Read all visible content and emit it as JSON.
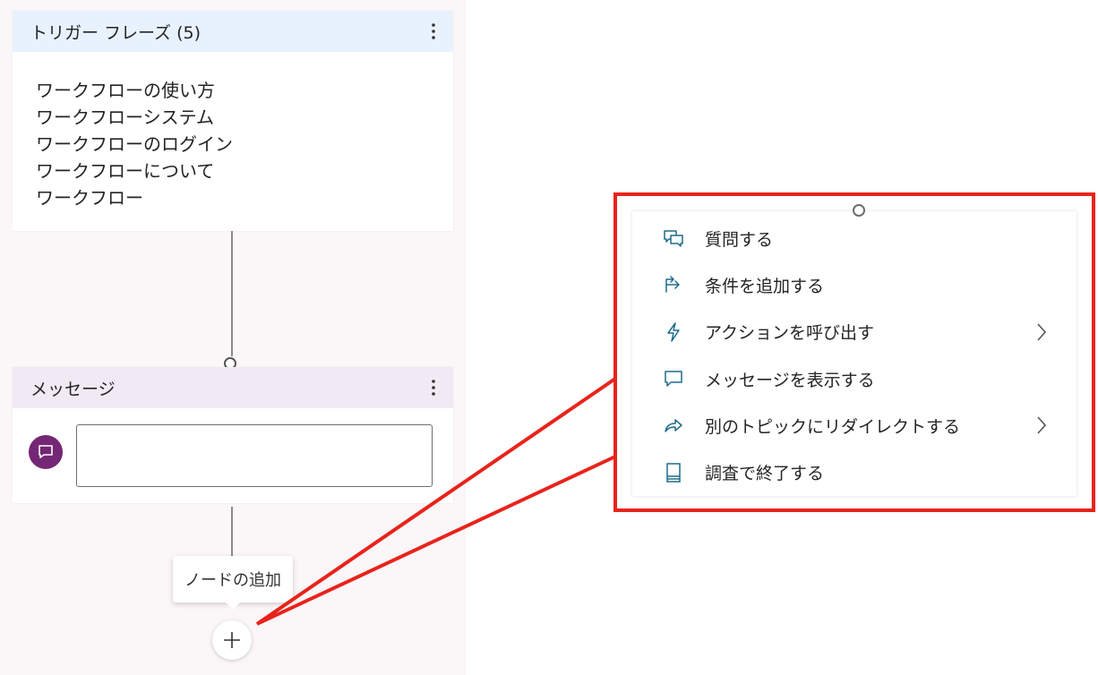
{
  "canvas": {
    "trigger_card": {
      "title": "トリガー フレーズ (5)",
      "phrases": [
        "ワークフローの使い方",
        "ワークフローシステム",
        "ワークフローのログイン",
        "ワークフローについて",
        "ワークフロー"
      ]
    },
    "message_card": {
      "title": "メッセージ",
      "input_value": ""
    },
    "add_node_tooltip": "ノードの追加"
  },
  "menu": {
    "items": [
      {
        "label": "質問する",
        "icon": "question-icon",
        "has_submenu": false
      },
      {
        "label": "条件を追加する",
        "icon": "condition-branch-icon",
        "has_submenu": false
      },
      {
        "label": "アクションを呼び出す",
        "icon": "lightning-icon",
        "has_submenu": true
      },
      {
        "label": "メッセージを表示する",
        "icon": "message-bubble-icon",
        "has_submenu": false
      },
      {
        "label": "別のトピックにリダイレクトする",
        "icon": "redirect-arrow-icon",
        "has_submenu": true
      },
      {
        "label": "調査で終了する",
        "icon": "survey-end-icon",
        "has_submenu": false
      }
    ]
  },
  "colors": {
    "trigger_header": "#e8f2fe",
    "message_header": "#f1e9f3",
    "avatar": "#742774",
    "highlight": "#e8231b",
    "menu_icon": "#1f6b8a"
  }
}
